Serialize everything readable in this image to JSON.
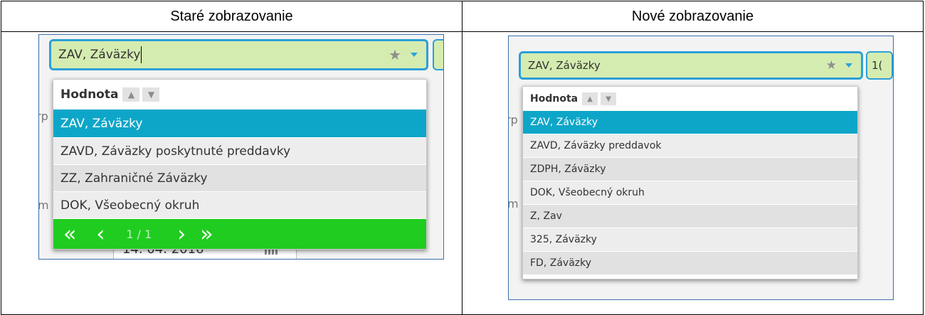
{
  "headers": {
    "old": "Staré zobrazovanie",
    "new": "Nové zobrazovanie"
  },
  "old_view": {
    "combo_value": "ZAV, Závӓzky",
    "sort_header": "Hodnota",
    "rows": [
      "ZAV, Závӓzky",
      "ZAVD, Závӓzky poskytnuté preddavky",
      "ZZ, Zahraničné Závӓzky",
      "DOK, Všeobecný okruh"
    ],
    "pager": {
      "first": "«",
      "prev": "‹",
      "page": "1 / 1",
      "next": "›",
      "last": "»"
    },
    "behind_text": {
      "a": "rp",
      "b": "m",
      "date": "14. 04. 2016"
    }
  },
  "new_view": {
    "combo_value": "ZAV, Závӓzky",
    "next_field": "1(",
    "sort_header": "Hodnota",
    "rows": [
      "ZAV, Závӓzky",
      "ZAVD, Závӓzky preddavok",
      "ZDPH, Závӓzky",
      "DOK, Všeobecný okruh",
      "Z, Zav",
      "325, Závӓzky",
      "FD, Závӓzky"
    ],
    "behind_text": {
      "a": "rp",
      "b": "m"
    }
  },
  "colors": {
    "selected": "#0ea6c8",
    "field_bg": "#d5ecb1",
    "field_border": "#2d9fd6",
    "pager": "#20cc20"
  },
  "icons": [
    "star-icon",
    "dropdown-arrow-icon",
    "sort-up-icon",
    "sort-down-icon",
    "first-page-icon",
    "prev-page-icon",
    "next-page-icon",
    "last-page-icon",
    "calendar-icon"
  ]
}
